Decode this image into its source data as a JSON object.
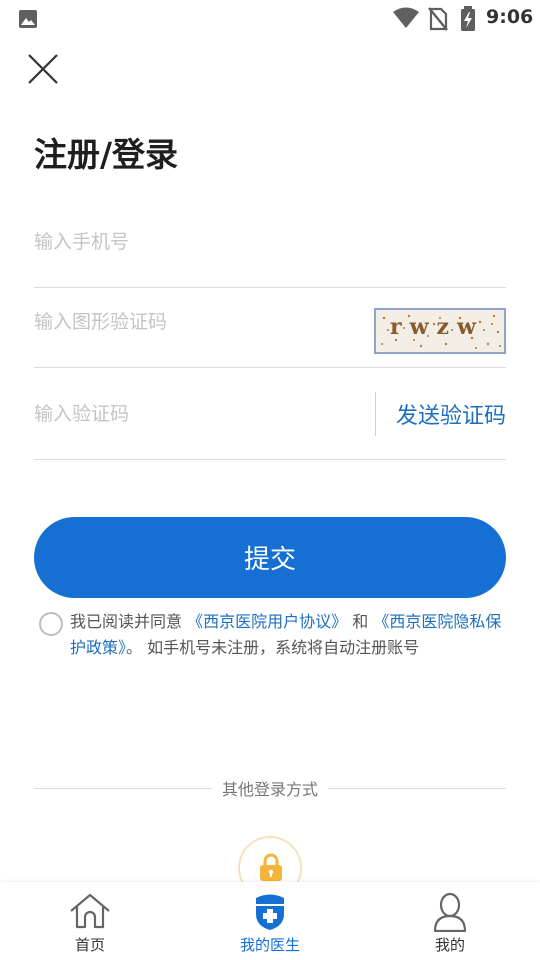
{
  "status_bar": {
    "time": "9:06",
    "icons": [
      "gallery-icon",
      "wifi-icon",
      "no-sim-icon",
      "battery-charging-icon"
    ]
  },
  "title": "注册/登录",
  "phone_field": {
    "placeholder": "输入手机号",
    "value": ""
  },
  "captcha_field": {
    "placeholder": "输入图形验证码",
    "value": "",
    "captcha_text": "rwzw"
  },
  "code_field": {
    "placeholder": "输入验证码",
    "value": "",
    "send_label": "发送验证码"
  },
  "submit_label": "提交",
  "agreement": {
    "checked": false,
    "prefix": "我已阅读并同意",
    "link1": "《西京医院用户协议》",
    "and": "和",
    "link2": "《西京医院隐私保护政策》",
    "suffix": "。 如手机号未注册，系统将自动注册账号"
  },
  "other_login": {
    "label": "其他登录方式",
    "icon": "lock-icon"
  },
  "tabbar": {
    "tabs": [
      {
        "label": "首页",
        "icon": "home-icon",
        "active": false
      },
      {
        "label": "我的医生",
        "icon": "doctor-icon",
        "active": true
      },
      {
        "label": "我的",
        "icon": "user-icon",
        "active": false
      }
    ]
  },
  "colors": {
    "primary": "#1670d3",
    "link": "#1e6fc2",
    "lock": "#f5b43a"
  }
}
